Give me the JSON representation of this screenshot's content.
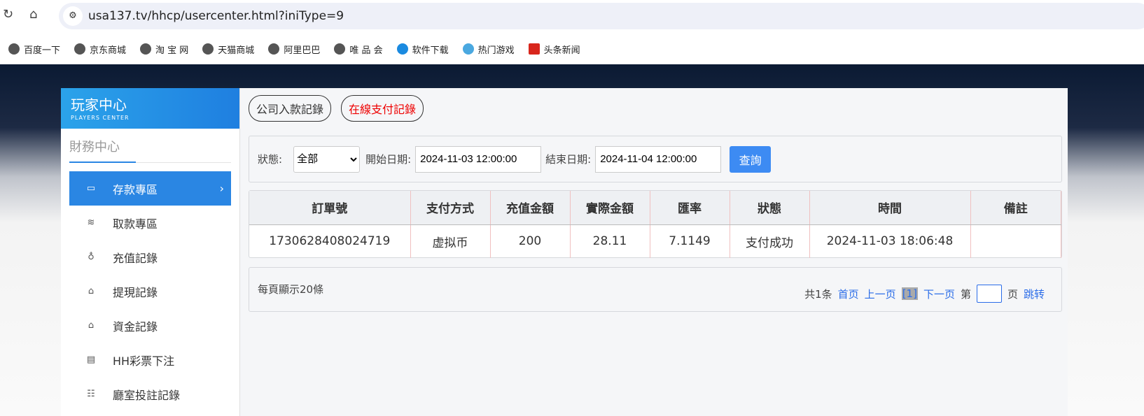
{
  "browser": {
    "url": "usa137.tv/hhcp/usercenter.html?iniType=9",
    "bookmarks": [
      "百度一下",
      "京东商城",
      "淘 宝 网",
      "天猫商城",
      "阿里巴巴",
      "唯 品 会",
      "软件下载",
      "热门游戏",
      "头条新闻"
    ]
  },
  "sidebar": {
    "title": "玩家中心",
    "subtitle": "PLAYERS CENTER",
    "section": "財務中心",
    "items": [
      {
        "label": "存款專區",
        "icon": "card-icon"
      },
      {
        "label": "取款專區",
        "icon": "hand-money-icon"
      },
      {
        "label": "充值記錄",
        "icon": "money-bag-icon"
      },
      {
        "label": "提現記錄",
        "icon": "withdraw-icon"
      },
      {
        "label": "資金記錄",
        "icon": "funds-icon"
      },
      {
        "label": "HH彩票下注",
        "icon": "list-icon"
      },
      {
        "label": "廳室投註記錄",
        "icon": "list-detail-icon"
      }
    ]
  },
  "tabs": [
    {
      "label": "公司入款記錄"
    },
    {
      "label": "在線支付記錄",
      "color": "#e00000"
    }
  ],
  "filter": {
    "status_label": "狀態:",
    "status_value": "全部",
    "start_label": "開始日期:",
    "start_value": "2024-11-03 12:00:00",
    "end_label": "結束日期:",
    "end_value": "2024-11-04 12:00:00",
    "query": "查詢"
  },
  "table": {
    "headers": [
      "訂單號",
      "支付方式",
      "充值金額",
      "實際金額",
      "匯率",
      "狀態",
      "時間",
      "備註"
    ],
    "rows": [
      [
        "1730628408024719",
        "虚拟币",
        "200",
        "28.11",
        "7.1149",
        "支付成功",
        "2024-11-03 18:06:48",
        ""
      ]
    ]
  },
  "pager": {
    "per_page": "每頁顯示20條",
    "total": "共1条",
    "first": "首页",
    "prev": "上一页",
    "current": "[1]",
    "next": "下一页",
    "page_prefix": "第",
    "page_suffix": "页",
    "jump": "跳转"
  }
}
